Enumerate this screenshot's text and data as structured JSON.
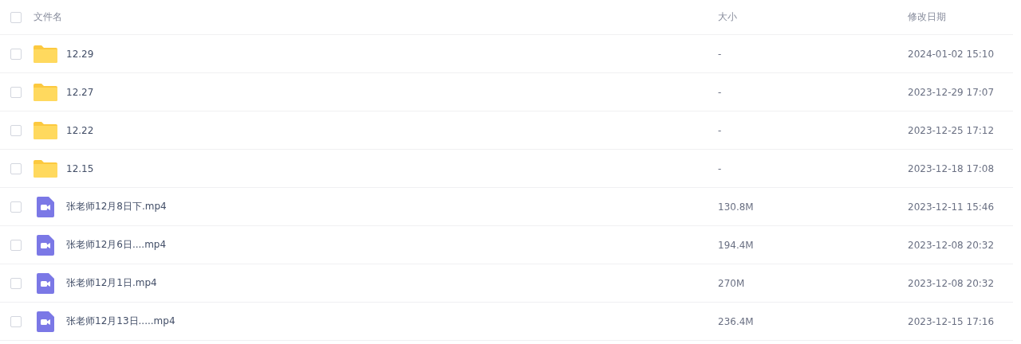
{
  "table": {
    "select_all": {
      "checked": false
    },
    "columns": [
      "文件名",
      "大小",
      "修改日期"
    ],
    "rows": [
      {
        "kind": "folder",
        "name": "12.29",
        "size": "-",
        "modified": "2024-01-02 15:10",
        "checked": false
      },
      {
        "kind": "folder",
        "name": "12.27",
        "size": "-",
        "modified": "2023-12-29 17:07",
        "checked": false
      },
      {
        "kind": "folder",
        "name": "12.22",
        "size": "-",
        "modified": "2023-12-25 17:12",
        "checked": false
      },
      {
        "kind": "folder",
        "name": "12.15",
        "size": "-",
        "modified": "2023-12-18 17:08",
        "checked": false
      },
      {
        "kind": "video",
        "name": "张老师12月8日下.mp4",
        "size": "130.8M",
        "modified": "2023-12-11 15:46",
        "checked": false
      },
      {
        "kind": "video",
        "name": "张老师12月6日....mp4",
        "size": "194.4M",
        "modified": "2023-12-08 20:32",
        "checked": false
      },
      {
        "kind": "video",
        "name": "张老师12月1日.mp4",
        "size": "270M",
        "modified": "2023-12-08 20:32",
        "checked": false
      },
      {
        "kind": "video",
        "name": "张老师12月13日.....mp4",
        "size": "236.4M",
        "modified": "2023-12-15 17:16",
        "checked": false
      }
    ]
  }
}
